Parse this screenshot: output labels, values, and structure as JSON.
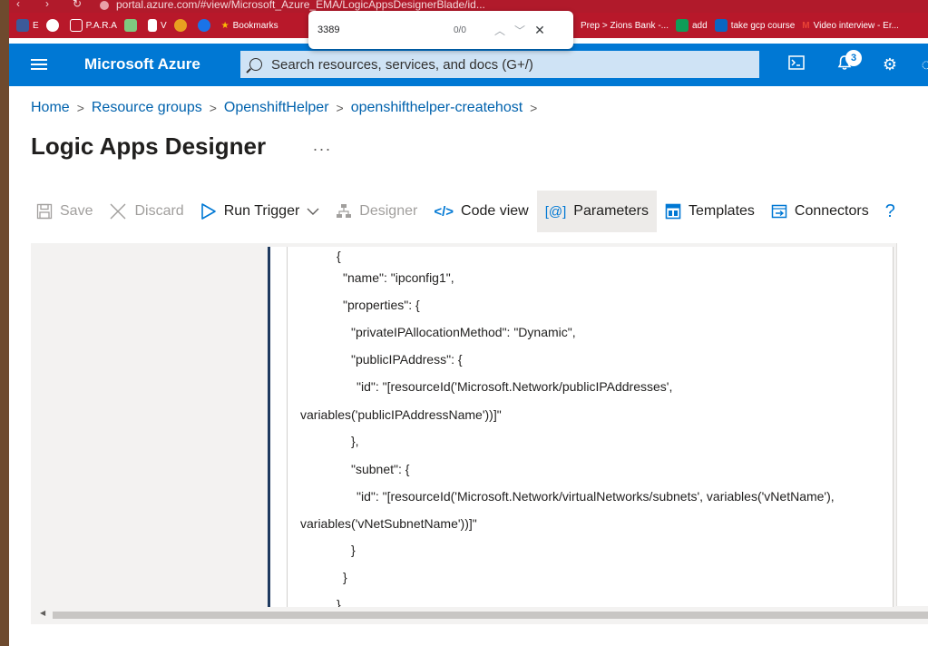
{
  "browser": {
    "url": "portal.azure.com/#view/Microsoft_Azure_EMA/LogicAppsDesignerBlade/id...",
    "bookmarks": [
      {
        "label": "E",
        "color": "#3c5a99"
      },
      {
        "label": "",
        "color": "#ffffff"
      },
      {
        "label": "P.A.R.A",
        "color": "#f4c20d"
      },
      {
        "label": "",
        "color": "#7fc97f"
      },
      {
        "label": "V",
        "color": "#ffffff"
      },
      {
        "label": "",
        "color": "#e8a020"
      },
      {
        "label": "",
        "color": "#1a73e8"
      },
      {
        "label": "Bookmarks",
        "color": "#fbbc04"
      }
    ],
    "bookmarks_right": [
      {
        "label": "Prep > Zions Bank -...",
        "color": "#ffffff"
      },
      {
        "label": "add",
        "color": "#0f9d58"
      },
      {
        "label": "take gcp course",
        "color": "#0a66c2"
      },
      {
        "label": "Video interview - Er...",
        "color": "#ea4335"
      }
    ]
  },
  "find": {
    "query": "3389",
    "count": "0/0"
  },
  "header": {
    "brand": "Microsoft Azure",
    "search_placeholder": "Search resources, services, and docs (G+/)",
    "notification_count": "3"
  },
  "breadcrumb": [
    "Home",
    "Resource groups",
    "OpenshiftHelper",
    "openshifthelper-createhost"
  ],
  "page": {
    "title": "Logic Apps Designer",
    "more": "..."
  },
  "toolbar": {
    "save": "Save",
    "discard": "Discard",
    "run_trigger": "Run Trigger",
    "designer": "Designer",
    "code_view": "Code view",
    "parameters": "Parameters",
    "templates": "Templates",
    "connectors": "Connectors",
    "help": "?"
  },
  "code": {
    "lines": [
      "{",
      "\"name\": \"ipconfig1\",",
      "\"properties\": {",
      "\"privateIPAllocationMethod\": \"Dynamic\",",
      "\"publicIPAddress\": {",
      "\"id\": \"[resourceId('Microsoft.Network/publicIPAddresses',",
      "variables('publicIPAddressName'))]\"",
      "},",
      "\"subnet\": {",
      "\"id\": \"[resourceId('Microsoft.Network/virtualNetworks/subnets', variables('vNetName'),",
      "variables('vNetSubnetName'))]\"",
      "}",
      "}",
      "}"
    ]
  },
  "colors": {
    "azure_blue": "#0078d4",
    "link_blue": "#0062ad",
    "browser_red": "#b8182a"
  }
}
